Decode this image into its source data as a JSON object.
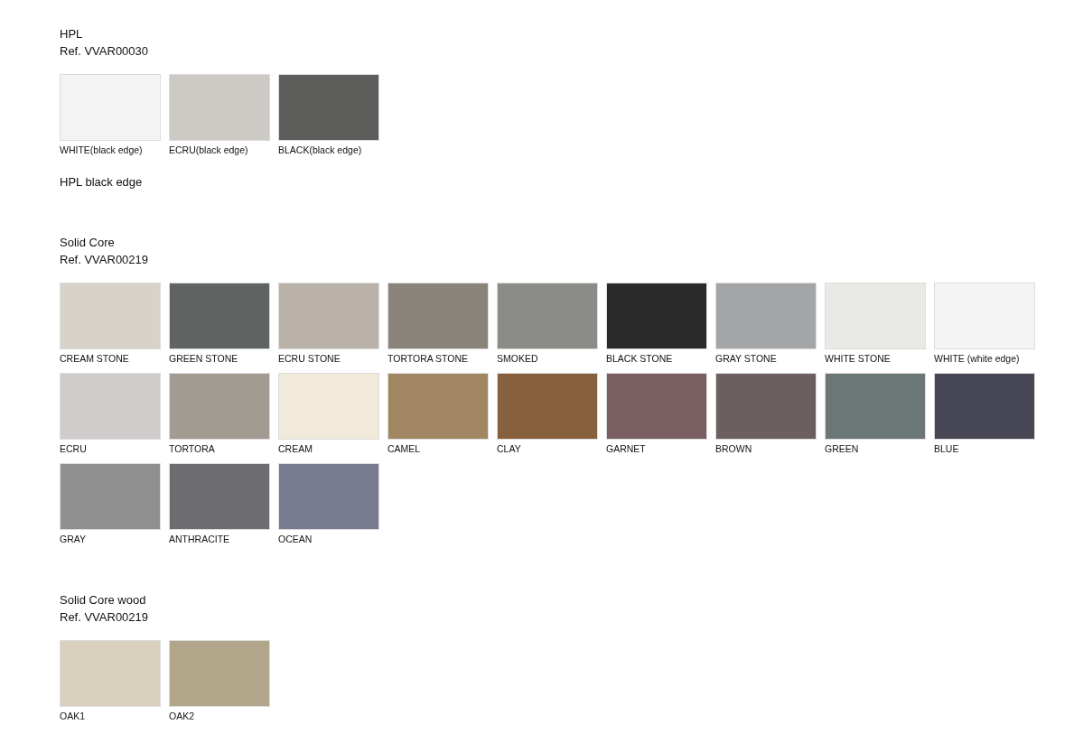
{
  "sections": [
    {
      "title": "HPL",
      "ref": "Ref. VVAR00030",
      "swatches": [
        {
          "label": "WHITE(black edge)",
          "color": "#f3f3f3"
        },
        {
          "label": "ECRU(black edge)",
          "color": "#cdcac5"
        },
        {
          "label": "BLACK(black edge)",
          "color": "#5d5d5c"
        }
      ],
      "note": "HPL black edge"
    },
    {
      "title": "Solid Core",
      "ref": "Ref. VVAR00219",
      "swatches": [
        {
          "label": "CREAM STONE",
          "color": "#d8d3ca"
        },
        {
          "label": "GREEN STONE",
          "color": "#5f6463"
        },
        {
          "label": "ECRU STONE",
          "color": "#bab2a8"
        },
        {
          "label": "TORTORA STONE",
          "color": "#8a8379"
        },
        {
          "label": "SMOKED",
          "color": "#8b8b87"
        },
        {
          "label": "BLACK STONE",
          "color": "#2a2a2a"
        },
        {
          "label": "GRAY STONE",
          "color": "#a4a5a6"
        },
        {
          "label": "WHITE STONE",
          "color": "#e9e9e6"
        },
        {
          "label": "WHITE (white edge)",
          "color": "#f4f4f4"
        },
        {
          "label": "ECRU",
          "color": "#cfcccb"
        },
        {
          "label": "TORTORA",
          "color": "#a29b91"
        },
        {
          "label": "CREAM",
          "color": "#f1e9da"
        },
        {
          "label": "CAMEL",
          "color": "#a18761"
        },
        {
          "label": "CLAY",
          "color": "#87603e"
        },
        {
          "label": "GARNET",
          "color": "#7a5e61"
        },
        {
          "label": "BROWN",
          "color": "#6b605f"
        },
        {
          "label": "GREEN",
          "color": "#6b7776"
        },
        {
          "label": "BLUE",
          "color": "#464655"
        },
        {
          "label": "GRAY",
          "color": "#8f8f8f"
        },
        {
          "label": "ANTHRACITE",
          "color": "#6d6c71"
        },
        {
          "label": "OCEAN",
          "color": "#777b90"
        }
      ]
    },
    {
      "title": "Solid Core wood",
      "ref": "Ref. VVAR00219",
      "swatches": [
        {
          "label": "OAK1",
          "color": "#d9d0bd"
        },
        {
          "label": "OAK2",
          "color": "#b2a68a"
        }
      ]
    }
  ]
}
